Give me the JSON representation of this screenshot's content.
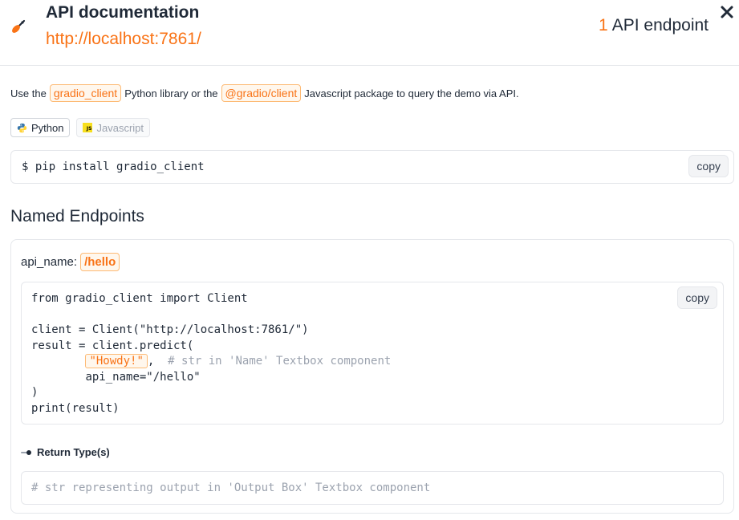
{
  "header": {
    "title": "API documentation",
    "url": "http://localhost:7861/",
    "endpoint_count": "1",
    "endpoint_label": "API endpoint"
  },
  "intro": {
    "prefix": "Use the",
    "python_lib": "gradio_client",
    "middle": "Python library or the",
    "js_lib": "@gradio/client",
    "suffix": "Javascript package to query the demo via API."
  },
  "languages": [
    {
      "label": "Python",
      "icon": "python-icon",
      "active": true
    },
    {
      "label": "Javascript",
      "icon": "javascript-icon",
      "active": false
    }
  ],
  "install": {
    "command": "$ pip install gradio_client",
    "copy_label": "copy"
  },
  "named_endpoints": {
    "title": "Named Endpoints",
    "api_name_label": "api_name:",
    "api_name": "/hello",
    "copy_label": "copy",
    "code": {
      "line1": "from gradio_client import Client",
      "line2": "client = Client(\"http://localhost:7861/\")",
      "line3": "result = client.predict(",
      "arg_value": "\"Howdy!\"",
      "arg_comment": "# str in 'Name' Textbox component",
      "line5": "api_name=\"/hello\"",
      "line6": ")",
      "line7": "print(result)"
    },
    "return_label": "Return Type(s)",
    "return_comment": "# str representing output in 'Output Box' Textbox component"
  },
  "colors": {
    "accent": "#f97316",
    "text": "#1f2937",
    "comment": "#9ca3af"
  }
}
